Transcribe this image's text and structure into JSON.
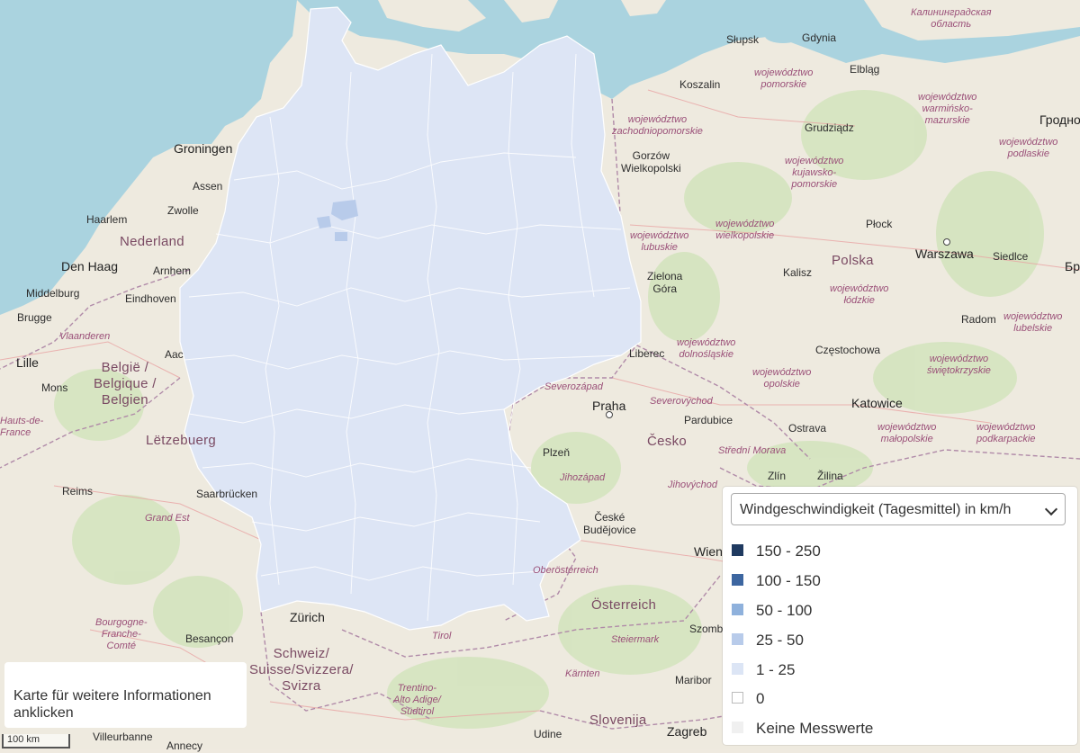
{
  "map": {
    "labels": {
      "polska_region": "Калининградская\nобласть",
      "slupsk": "Słupsk",
      "gdynia": "Gdynia",
      "elblag": "Elbląg",
      "koszalin": "Koszalin",
      "pomorskie": "województwo\npomorskie",
      "warminsko": "województwo\nwarmińsko-\nmazurskie",
      "zachodnio": "województwo\nzachodniopomorskie",
      "grudziadz": "Grudziądz",
      "grodno": "Гродно",
      "podlaskie": "województwo\npodlaskie",
      "kujawsko": "województwo\nkujawsko-\npomorskie",
      "gorzow": "Gorzów\nWielkopolski",
      "wielkopolskie": "województwo\nwielkopolskie",
      "plock": "Płock",
      "lubuskie": "województwo\nlubuskie",
      "polska": "Polska",
      "warszawa": "Warszawa",
      "siedlce": "Siedlce",
      "zielona": "Zielona\nGóra",
      "kalisz": "Kalisz",
      "lodzkie": "województwo\nłódzkie",
      "radom": "Radom",
      "lubelskie": "województwo\nlubelskie",
      "dolnoslaskie": "województwo\ndolnośląskie",
      "czestochowa": "Częstochowa",
      "swietokrzyskie": "województwo\nświętokrzyskie",
      "opolskie": "województwo\nopolskie",
      "liberec": "Liberec",
      "katowice": "Katowice",
      "severozapad": "Severozápad",
      "praha": "Praha",
      "severovychod": "Severovýchod",
      "pardubice": "Pardubice",
      "ostrava": "Ostrava",
      "malopolskie": "województwo\nmałopolskie",
      "podkarpackie": "województwo\npodkarpackie",
      "plzen": "Plzeň",
      "cesko": "Česko",
      "stredni_morava": "Střední Morava",
      "jihozapad": "Jihozápad",
      "zlin": "Zlín",
      "zilina": "Žilina",
      "jihovychod": "Jihovýchod",
      "ceske": "České\nBudějovice",
      "wien": "Wien",
      "oberosterreich": "Oberösterreich",
      "osterreich": "Österreich",
      "steiermark": "Steiermark",
      "sombathely": "Szombathely",
      "karnten": "Kärnten",
      "maribor": "Maribor",
      "zurich": "Zürich",
      "schweiz": "Schweiz/\nSuisse/Svizzera/\nSvizra",
      "tirol": "Tirol",
      "trentino": "Trentino-\nAlto Adige/\nSüdtirol",
      "slovenija": "Slovenija",
      "udine": "Udine",
      "zagreb": "Zagreb",
      "groningen": "Groningen",
      "assen": "Assen",
      "zwolle": "Zwolle",
      "haarlem": "Haarlem",
      "nederland": "Nederland",
      "den_haag": "Den Haag",
      "arnhem": "Arnhem",
      "middelburg": "Middelburg",
      "eindhoven": "Eindhoven",
      "brugge": "Brugge",
      "vlaanderen": "Vlaanderen",
      "lille": "Lille",
      "belgie": "België /\nBelgique /\nBelgien",
      "mons": "Mons",
      "hauts": "Hauts-de-\nFrance",
      "letzebuerg": "Lëtzebuerg",
      "reims": "Reims",
      "saarbrucken": "Saarbrücken",
      "grand_est": "Grand Est",
      "bourgogne": "Bourgogne-\nFranche-\nComté",
      "besancon": "Besançon",
      "villeurbanne": "Villeurbanne",
      "annecy": "Annecy",
      "aachen": "Aac",
      "gronx": "O",
      "br": "Бр",
      "lpartial": "Le",
      "is": "is"
    }
  },
  "legend": {
    "select_value": "Windgeschwindigkeit (Tagesmittel) in km/h",
    "items": [
      {
        "label": "150 - 250",
        "color": "#1f3a60"
      },
      {
        "label": "100 - 150",
        "color": "#3d66a0"
      },
      {
        "label": "50 - 100",
        "color": "#8fb1dc"
      },
      {
        "label": "25 - 50",
        "color": "#b8cbea"
      },
      {
        "label": "1 - 25",
        "color": "#dce5f5"
      },
      {
        "label": "0",
        "color": "#ffffff"
      },
      {
        "label": "Keine Messwerte",
        "color": "#f0f0f0"
      }
    ]
  },
  "info": {
    "text": "Karte für weitere Informationen anklicken"
  },
  "scale": {
    "label": "100 km"
  },
  "colors": {
    "sea": "#aad3df",
    "land": "#f2efe9",
    "germany_fill": "#dde5f5",
    "germany_border": "#ffffff"
  }
}
